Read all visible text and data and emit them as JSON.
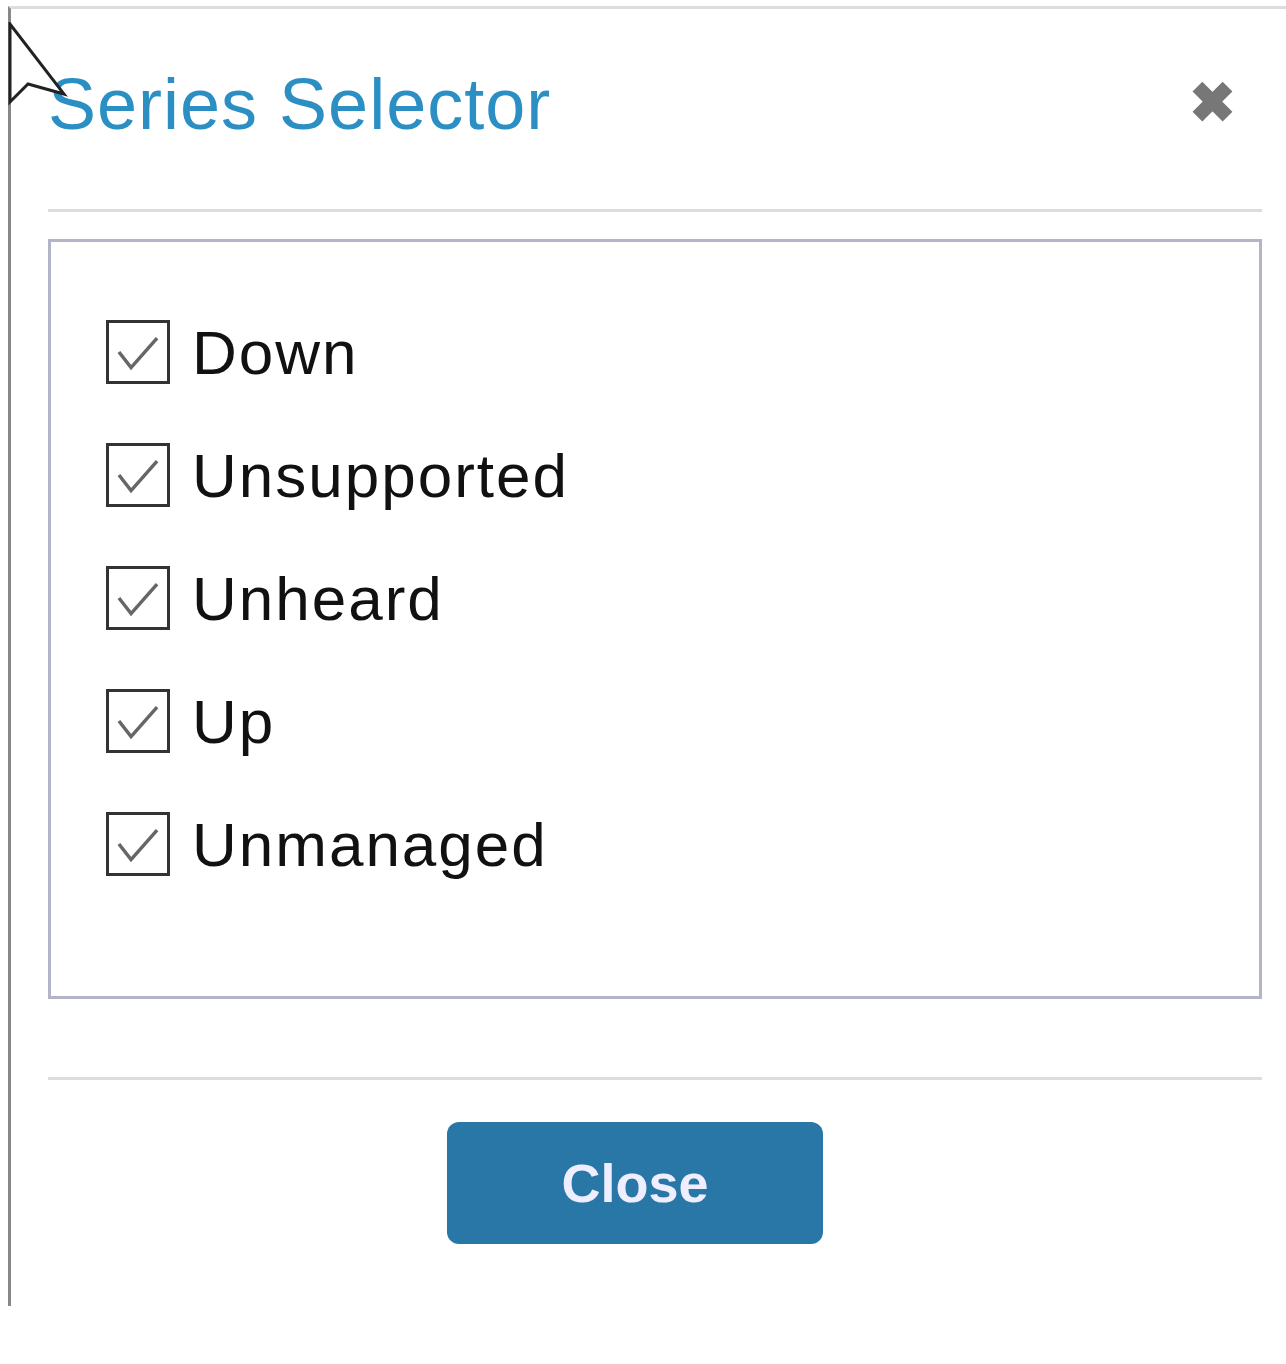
{
  "dialog": {
    "title": "Series Selector",
    "close_icon": "✖"
  },
  "series": [
    {
      "label": "Down",
      "checked": true
    },
    {
      "label": "Unsupported",
      "checked": true
    },
    {
      "label": "Unheard",
      "checked": true
    },
    {
      "label": "Up",
      "checked": true
    },
    {
      "label": "Unmanaged",
      "checked": true
    }
  ],
  "buttons": [
    "Close"
  ]
}
